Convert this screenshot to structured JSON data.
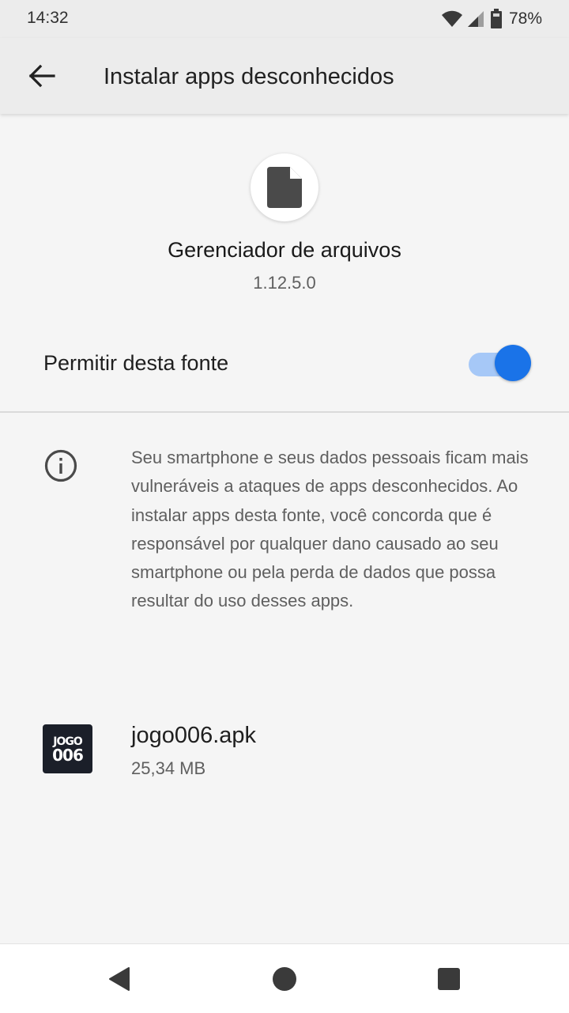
{
  "status_bar": {
    "time": "14:32",
    "battery_percent": "78%",
    "icons": [
      "wifi-icon",
      "cell-signal-icon",
      "battery-icon"
    ]
  },
  "app_bar": {
    "title": "Instalar apps desconhecidos",
    "back_icon": "arrow-back-icon"
  },
  "app": {
    "icon": "file-icon",
    "name": "Gerenciador de arquivos",
    "version": "1.12.5.0"
  },
  "permission": {
    "label": "Permitir desta fonte",
    "enabled": true
  },
  "warning": {
    "icon": "info-icon",
    "text": "Seu smartphone e seus dados pessoais ficam mais vulneráveis a ataques de apps desconhecidos. Ao instalar apps desta fonte, você concorda que é responsável por qualquer dano causado ao seu smartphone ou pela perda de dados que possa resultar do uso desses apps."
  },
  "file": {
    "icon_text_line1": "JOGO",
    "icon_text_line2": "006",
    "name": "jogo006.apk",
    "size": "25,34 MB"
  },
  "nav_bar": {
    "icons": [
      "nav-back-icon",
      "nav-home-icon",
      "nav-recents-icon"
    ]
  },
  "colors": {
    "accent": "#1a73e8",
    "switch_track": "#a6c8f7",
    "background": "#f5f5f5",
    "app_bar": "#ececec",
    "secondary_text": "#5f5f5f"
  }
}
